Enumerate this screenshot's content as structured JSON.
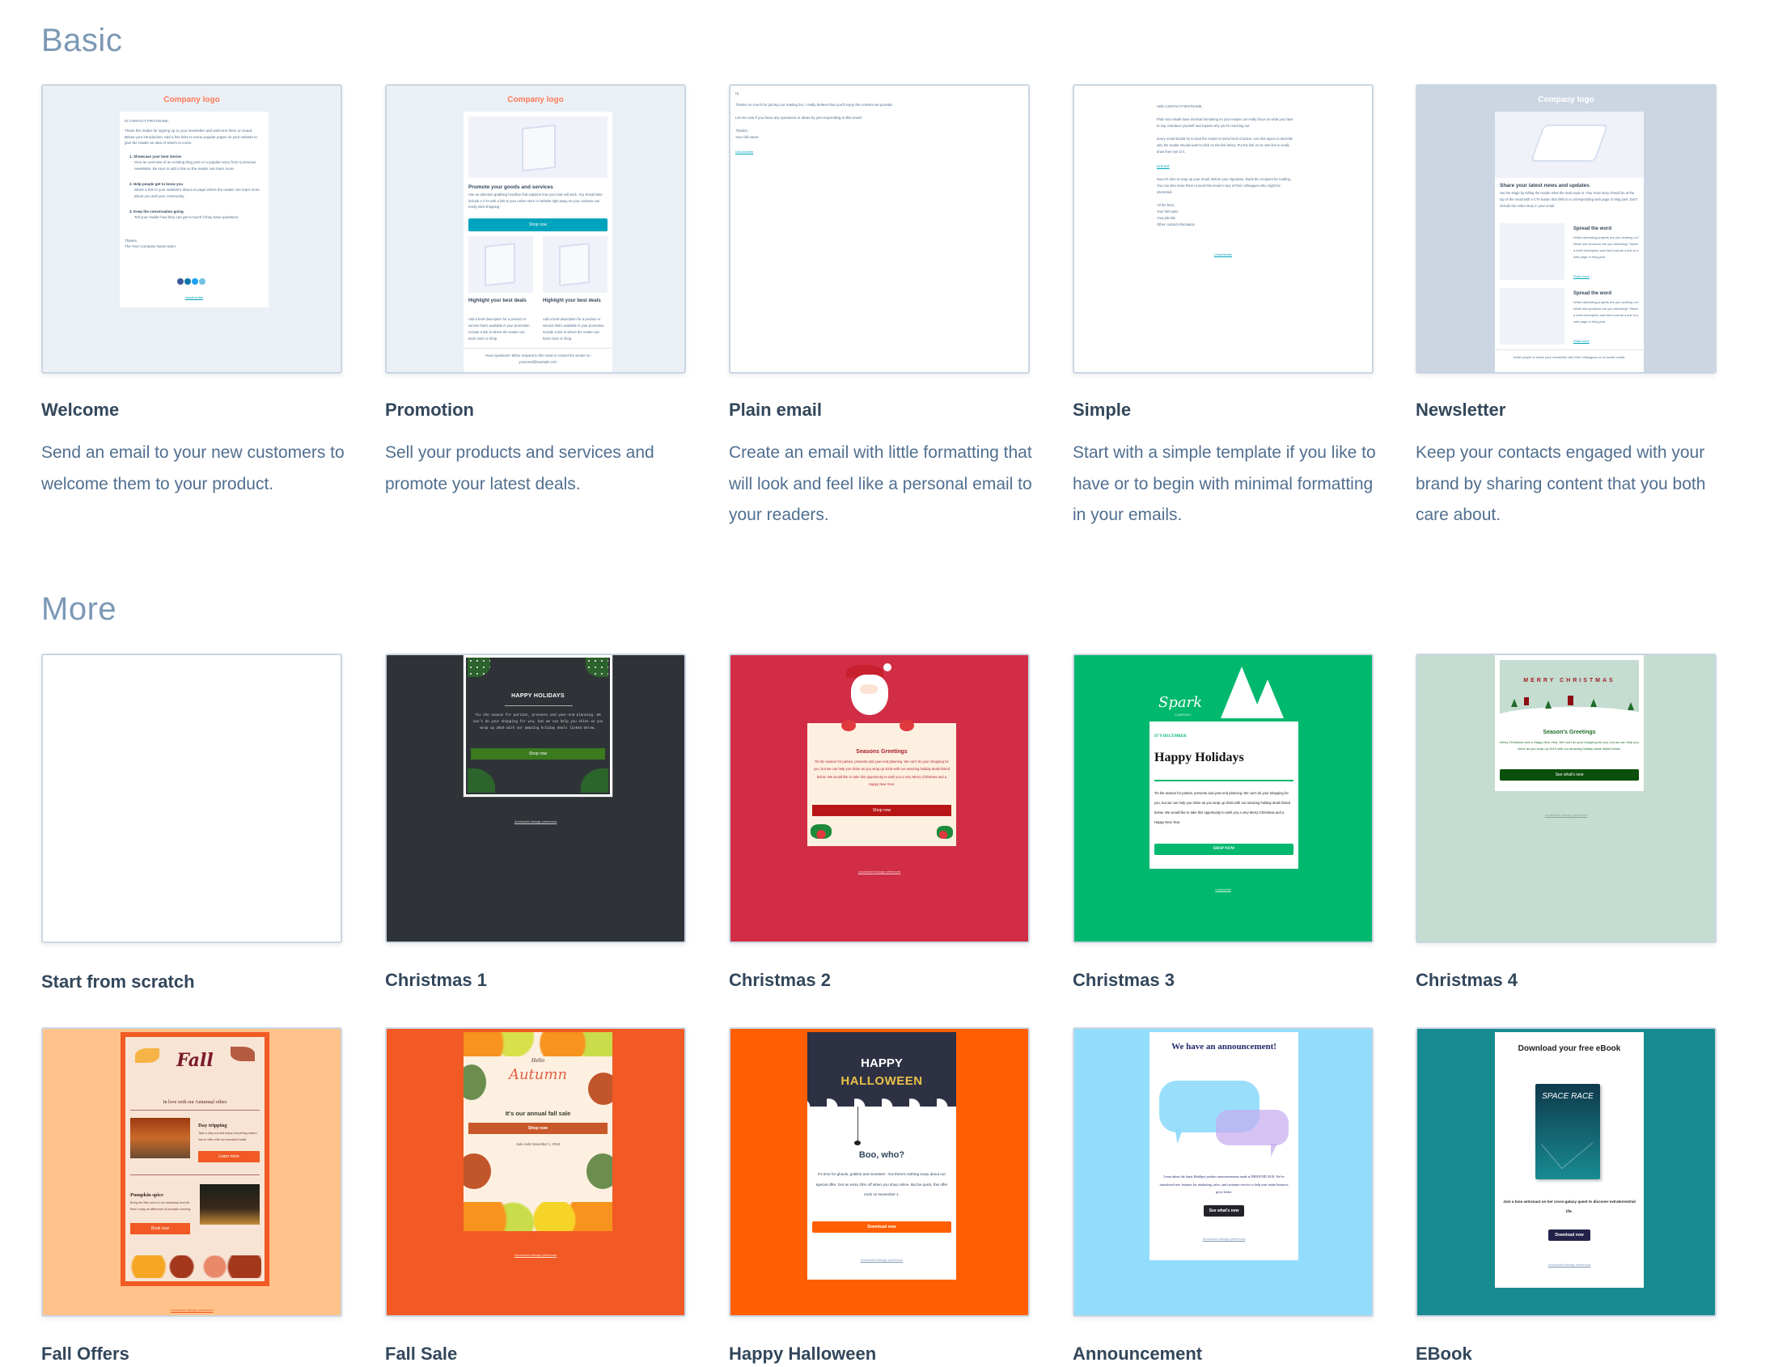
{
  "sections": {
    "basic": {
      "title": "Basic"
    },
    "more": {
      "title": "More"
    }
  },
  "basic_templates": [
    {
      "name": "Welcome",
      "description": "Send an email to your new customers to welcome them to your product.",
      "preview": {
        "logo": "Company logo",
        "greeting": "Hi CONTACT.FIRSTNAME,",
        "intro": "Thank the reader for signing up to your newsletter and welcome them on board. Below your introduction, add a few links to some popular pages on your website to give the reader an idea of what's to come.",
        "items": [
          {
            "title": "1. Showcase your best stories",
            "text": "Give an overview of an existing blog post or a popular story from a previous newsletter. Be sure to add a link so the reader can learn more."
          },
          {
            "title": "2. Help people get to know you",
            "text": "Share a link to your website's about us page where the reader can learn more about you and your community."
          },
          {
            "title": "3. Keep the conversation going",
            "text": "Tell your reader how they can get in touch if they have questions."
          }
        ],
        "signoff": "Thanks,",
        "signature": "The Your Company Name team",
        "social_icons": [
          "facebook-icon",
          "linkedin-icon",
          "twitter-icon",
          "email-icon"
        ],
        "footer_link": "Unsubscribe"
      }
    },
    {
      "name": "Promotion",
      "description": "Sell your products and services and promote your latest deals.",
      "preview": {
        "logo": "Company logo",
        "heading": "Promote your goods and services",
        "body": "Use an attention-grabbing headline that explains how your sale will work. You should also include a CTA with a link to your online store or website right away so your contacts can easily start shopping.",
        "cta": "Shop now",
        "sub_heading": "Highlight your best deals",
        "sub_body": "Add a brief description for a product or service that's available in your promotion. Include a link to where the reader can learn more or shop.",
        "footer": "Have questions? Either respond to this email or contact the sender on youremail@example.com"
      }
    },
    {
      "name": "Plain email",
      "description": "Create an email with little formatting that will look and feel like a personal email to your readers.",
      "preview": {
        "lines": [
          "Hi,",
          "Thanks so much for joining our mailing list. I really believe that you'll enjoy the content we provide.",
          "Let me now if you have any questions or ideas by just responding to this email.",
          "Thanks,",
          "Your full name"
        ],
        "footer_link": "Unsubscribe"
      }
    },
    {
      "name": "Simple",
      "description": "Start with a simple template if you like to have or to begin with minimal formatting in your emails.",
      "preview": {
        "lines": [
          "Hello CONTACT.FIRSTNAME,",
          "Plain text emails have minimal formatting so your reader can really focus on what you have to say. Introduce yourself and explain why you're reaching out.",
          "Every email should try to lead the reader to some kind of action. Use this space to describe why the reader should want to click on the link below. Put the link on its own line to really draw their eye to it.",
          "Link text",
          "Now it's time to wrap up your email. Before your signature, thank the recipient for reading. You can also invite them to send this email to any of their colleagues who might be interested.",
          "All the best,",
          "Your full name",
          "Your job title",
          "Other contact information"
        ],
        "footer_link": "Unsubscribe"
      }
    },
    {
      "name": "Newsletter",
      "description": "Keep your contacts engaged with your brand by sharing content that you both care about.",
      "preview": {
        "logo": "Company logo",
        "heading": "Share your latest news and updates",
        "body": "Set the stage by telling the reader what the main topic is. Your main story should be at the top of the email with a CTA button that links to a corresponding web page or blog post. Don't include the entire story in your email.",
        "article_title": "Spread the word",
        "article_body": "What interesting projects are you working on? What new products are you releasing? Share a brief description and then include a link to a web page or blog post.",
        "read_more": "Read more",
        "footer": "Invite people to share your newsletter with their colleagues or on social media."
      }
    }
  ],
  "more_templates": [
    {
      "name": "Start from scratch",
      "preview": {}
    },
    {
      "name": "Christmas 1",
      "preview": {
        "heading": "HAPPY HOLIDAYS",
        "body": "Tis the season for parties, presents and year-end planning. We can't do your shopping for you, but we can help you shine as you wrap up 2019 with our amazing holiday deals linked below.",
        "cta": "Shop now",
        "footer_links": "Unsubscribe  Manage preferences",
        "bg": "#2f3337",
        "accent": "#3b7a1f"
      }
    },
    {
      "name": "Christmas 2",
      "preview": {
        "heading": "Seasons Greetings",
        "body": "Tis the season for parties, presents and year-end planning. We can't do your shopping for you, but we can help you shine as you wrap up 2019 with our amazing holiday deals linked below. We would like to take this opportunity to wish you a very Merry Christmas and a Happy New Year.",
        "cta": "Shop now",
        "footer_links": "Unsubscribe  Manage preferences",
        "bg": "#d12d46",
        "accent": "#b81616"
      }
    },
    {
      "name": "Christmas 3",
      "preview": {
        "brand": "Spark",
        "brand_sub": "COMPANY",
        "eyebrow": "IT'S DECEMBER",
        "heading": "Happy Holidays",
        "body": "Tis the season for parties, presents and year-end planning. We can't do your shopping for you, but we can help you shine as you wrap up 2018 with our amazing holiday deals linked below. We would like to take this opportunity to wish you a very Merry Christmas and a Happy New Year.",
        "cta": "SHOP NOW",
        "footer_links": "Unsubscribe",
        "bg": "#00b86e"
      }
    },
    {
      "name": "Christmas 4",
      "preview": {
        "banner": "MERRY CHRISTMAS",
        "heading": "Season's Greetings",
        "body": "Merry Christmas and a Happy New Year. We can't do your shopping for you, but we can help you shine as you wrap up 2019 with our amazing holiday deals linked below.",
        "cta": "See what's new",
        "footer_links": "Unsubscribe  Manage preferences",
        "bg": "#c5dcd1",
        "accent": "#0a4f0a"
      }
    },
    {
      "name": "Fall Offers",
      "preview": {
        "hero": "Fall",
        "tagline": "In love with our Autumnal offers",
        "item1_title": "Day tripping",
        "item1_body": "Take a day out and enjoy everything nature has to offer with our woodland walk.",
        "item1_cta": "Learn more",
        "item2_title": "Pumpkin spice",
        "item2_body": "Bring the little ones to our workshop and let them enjoy an afternoon of pumpkin carving.",
        "item2_cta": "Book now",
        "footer_links": "Unsubscribe  Manage preferences",
        "bg": "#ffc28a",
        "accent": "#f15a24"
      }
    },
    {
      "name": "Fall Sale",
      "preview": {
        "hello": "Hello",
        "script": "Autumn",
        "heading": "It's our annual fall sale",
        "cta": "Shop now",
        "note": "Sale ends November 1, 2019",
        "footer_links": "Unsubscribe  Manage preferences",
        "bg": "#f15a24"
      }
    },
    {
      "name": "Happy Halloween",
      "preview": {
        "title_line1": "HAPPY",
        "title_line2": "HALLOWEEN",
        "heading": "Boo, who?",
        "body": "It's time for ghouls, goblins and monsters - but there's nothing scary about our special offer. Get an extra 20% off when you shop online. But be quick, this offer ends on November 1.",
        "cta": "Download now",
        "footer_links": "Unsubscribe  Manage preferences",
        "bg": "#ff5f00"
      }
    },
    {
      "name": "Announcement",
      "preview": {
        "heading": "We have an announcement!",
        "body": "Learn about the latest HubSpot product announcements made at INBOUND 2018. We've introduced new features for marketing, sales, and customer service to help your entire business grow better.",
        "cta": "See what's new",
        "footer_links": "Unsubscribe  Manage preferences",
        "bg": "#93ddfc"
      }
    },
    {
      "name": "EBook",
      "preview": {
        "heading": "Download your free eBook",
        "book_title": "SPACE RACE",
        "body": "Join a lone astronaut on her cross-galaxy quest to discover extraterrestrial life.",
        "cta": "Download now",
        "footer_links": "Unsubscribe  Manage preferences",
        "bg": "#188b91"
      }
    }
  ]
}
